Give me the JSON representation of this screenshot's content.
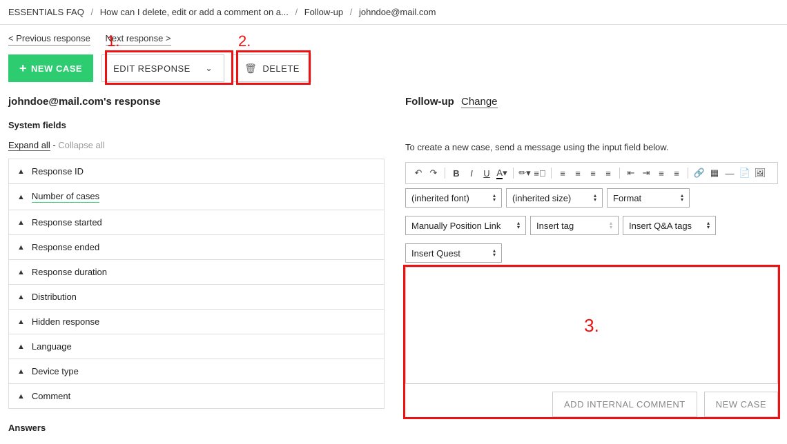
{
  "breadcrumb": [
    "ESSENTIALS FAQ",
    "How can I delete, edit or add a comment on a...",
    "Follow-up",
    "johndoe@mail.com"
  ],
  "nav": {
    "prev": "< Previous response",
    "next": "Next response >"
  },
  "annotations": {
    "one": "1.",
    "two": "2.",
    "three": "3."
  },
  "actions": {
    "new_case": "NEW CASE",
    "edit_response": "EDIT RESPONSE",
    "delete": "DELETE"
  },
  "left": {
    "title": "johndoe@mail.com's response",
    "system_fields": "System fields",
    "expand_all": "Expand all",
    "dash": " - ",
    "collapse_all": "Collapse all",
    "fields": [
      "Response ID",
      "Number of cases",
      "Response started",
      "Response ended",
      "Response duration",
      "Distribution",
      "Hidden response",
      "Language",
      "Device type",
      "Comment"
    ],
    "answers": "Answers"
  },
  "right": {
    "followup": "Follow-up",
    "change": "Change",
    "hint": "To create a new case, send a message using the input field below.",
    "selects": {
      "font": "(inherited font)",
      "size": "(inherited size)",
      "format": "Format",
      "position_link": "Manually Position Link",
      "insert_tag": "Insert tag",
      "insert_qa": "Insert Q&A tags",
      "insert_quest": "Insert Quest"
    },
    "buttons": {
      "add_comment": "ADD INTERNAL COMMENT",
      "new_case": "NEW CASE"
    }
  }
}
